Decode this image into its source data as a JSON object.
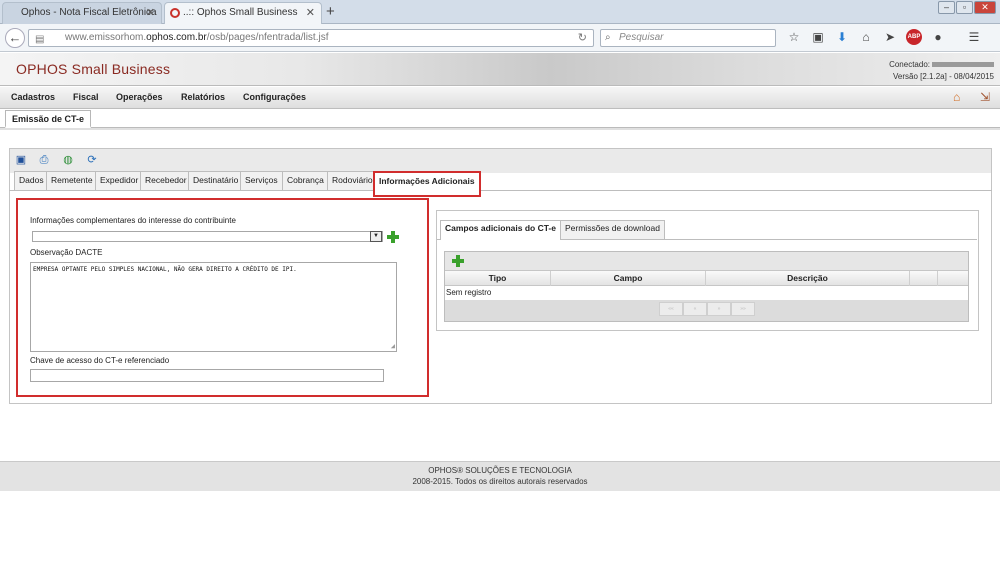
{
  "browser": {
    "tabs": [
      {
        "title": "Ophos - Nota Fiscal Eletrônica",
        "active": false
      },
      {
        "title": "..:: Ophos Small Business",
        "active": true
      }
    ],
    "url_prefix": "www.emissorhom.",
    "url_domain": "ophos.com.br",
    "url_path": "/osb/pages/nfentrada/list.jsf",
    "search_placeholder": "Pesquisar"
  },
  "app": {
    "brand": "OPHOS Small Business",
    "connected_label": "Conectado:",
    "version": "Versão [2.1.2a] - 08/04/2015"
  },
  "menu": {
    "items": [
      "Cadastros",
      "Fiscal",
      "Operações",
      "Relatórios",
      "Configurações"
    ]
  },
  "page_tab": "Emissão de CT-e",
  "inner_tabs": [
    "Dados",
    "Remetente",
    "Expedidor",
    "Recebedor",
    "Destinatário",
    "Serviços",
    "Cobrança",
    "Rodoviário",
    "Informações Adicionais"
  ],
  "form": {
    "info_label": "Informações complementares do interesse do contribuinte",
    "obs_label": "Observação DACTE",
    "obs_value": "EMPRESA OPTANTE PELO SIMPLES NACIONAL, NÃO GERA DIREITO A CRÉDITO DE IPI.",
    "chave_label": "Chave de acesso do CT-e referenciado"
  },
  "right_panel": {
    "tabs": [
      "Campos adicionais do CT-e",
      "Permissões de download"
    ],
    "columns": [
      "Tipo",
      "Campo",
      "Descrição"
    ],
    "empty_text": "Sem registro",
    "pager": [
      "««",
      "«",
      "»",
      "»»"
    ]
  },
  "footer": {
    "line1": "OPHOS® SOLUÇÕES E TECNOLOGIA",
    "line2": "2008-2015. Todos os direitos autorais reservados"
  }
}
